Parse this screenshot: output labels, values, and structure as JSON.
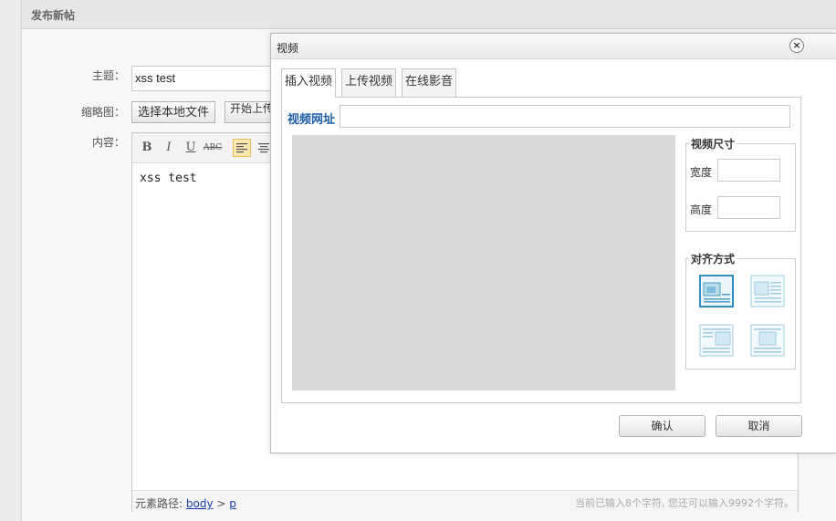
{
  "page": {
    "title": "发布新帖"
  },
  "form": {
    "subject_label": "主题：",
    "subject_value": "xss test",
    "thumbnail_label": "缩略图：",
    "choose_file_label": "选择本地文件",
    "upload_label": "开始上传",
    "content_label": "内容："
  },
  "editor": {
    "toolbar": {
      "bold": "B",
      "italic": "I",
      "underline": "U",
      "strike": "ABC"
    },
    "content": "xss test",
    "status": {
      "path_prefix": "元素路径:",
      "path_body": "body",
      "path_sep": ">",
      "path_p": "p",
      "count_text": "当前已输入8个字符, 您还可以输入9992个字符。"
    }
  },
  "dialog": {
    "title": "视频",
    "close_glyph": "×",
    "tabs": [
      {
        "label": "插入视频",
        "active": true
      },
      {
        "label": "上传视频",
        "active": false
      },
      {
        "label": "在线影音",
        "active": false
      }
    ],
    "url_label": "视频网址",
    "url_value": "",
    "size_legend": "视频尺寸",
    "width_label": "宽度",
    "height_label": "高度",
    "width_value": "",
    "height_value": "",
    "align_legend": "对齐方式",
    "align_options": [
      {
        "name": "none",
        "selected": true
      },
      {
        "name": "left",
        "selected": false
      },
      {
        "name": "right",
        "selected": false
      },
      {
        "name": "center",
        "selected": false
      }
    ],
    "confirm_label": "确认",
    "cancel_label": "取消"
  },
  "colors": {
    "accent_blue": "#1f5ea8",
    "link_blue": "#1a3fb0",
    "active_tool_bg": "#fbe7b0"
  }
}
